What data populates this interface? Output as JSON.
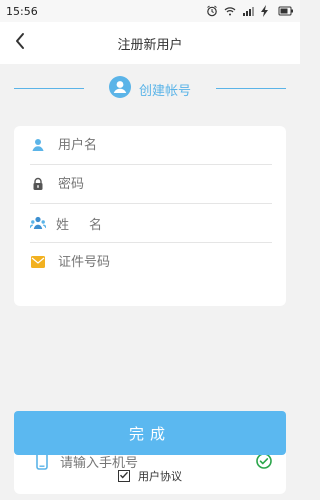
{
  "status_bar": {
    "time": "15:56",
    "battery_text": ""
  },
  "header": {
    "title": "注册新用户",
    "back_icon": "chevron-left-icon"
  },
  "section": {
    "title": "创建帐号",
    "icon": "user-circle-icon",
    "accent": "#5bb4e8"
  },
  "form": {
    "username_placeholder": "用户名",
    "password_placeholder": "密码",
    "name_label": "姓名",
    "id_placeholder": "证件号码"
  },
  "phone": {
    "placeholder": "请输入手机号",
    "phone_icon": "mobile-icon",
    "check_icon": "check-circle-icon"
  },
  "actions": {
    "done_label": "完成"
  },
  "agreement": {
    "label": "用户协议",
    "checked": true
  },
  "colors": {
    "accent": "#5bb4e8",
    "button": "#5bb8f0",
    "check_green": "#2aa54a",
    "id_icon": "#f2b120"
  }
}
